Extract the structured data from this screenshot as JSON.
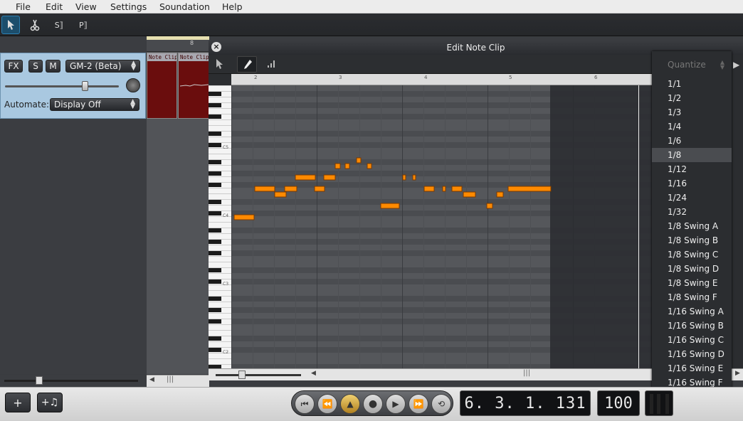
{
  "menubar": {
    "items": [
      "File",
      "Edit",
      "View",
      "Settings",
      "Soundation",
      "Help"
    ]
  },
  "toolbar": {
    "tools": [
      {
        "name": "pointer-tool",
        "icon": "cursor-icon",
        "active": true
      },
      {
        "name": "razor-tool",
        "icon": "scissors-icon",
        "active": false
      },
      {
        "name": "split-tool",
        "label": "S",
        "icon": "split-icon",
        "active": false
      },
      {
        "name": "paste-tool",
        "label": "P",
        "icon": "paste-icon",
        "active": false
      }
    ]
  },
  "track": {
    "fx_label": "FX",
    "solo_label": "S",
    "mute_label": "M",
    "instrument": "GM-2 (Beta)",
    "automate_label": "Automate:",
    "automate_value": "Display Off",
    "clips": [
      {
        "label": "Note Clip"
      },
      {
        "label": "Note Clip"
      }
    ]
  },
  "editor": {
    "title": "Edit Note Clip",
    "close_label": "×",
    "ruler_marks": [
      "2",
      "3",
      "4",
      "5",
      "6"
    ],
    "key_labels": [
      "C5",
      "C4",
      "C3",
      "C2"
    ],
    "note_color": "#ff8a00"
  },
  "quantize": {
    "placeholder": "Quantize",
    "selected": "1/8",
    "options": [
      "1/1",
      "1/2",
      "1/3",
      "1/4",
      "1/6",
      "1/8",
      "1/12",
      "1/16",
      "1/24",
      "1/32",
      "1/8 Swing A",
      "1/8 Swing B",
      "1/8 Swing C",
      "1/8 Swing D",
      "1/8 Swing E",
      "1/8 Swing F",
      "1/16 Swing A",
      "1/16 Swing B",
      "1/16 Swing C",
      "1/16 Swing D",
      "1/16 Swing E",
      "1/16 Swing F"
    ]
  },
  "transport": {
    "position": "6. 3. 1. 131",
    "tempo": "100",
    "add_track_label": "+",
    "add_instrument_label": "+♫"
  }
}
